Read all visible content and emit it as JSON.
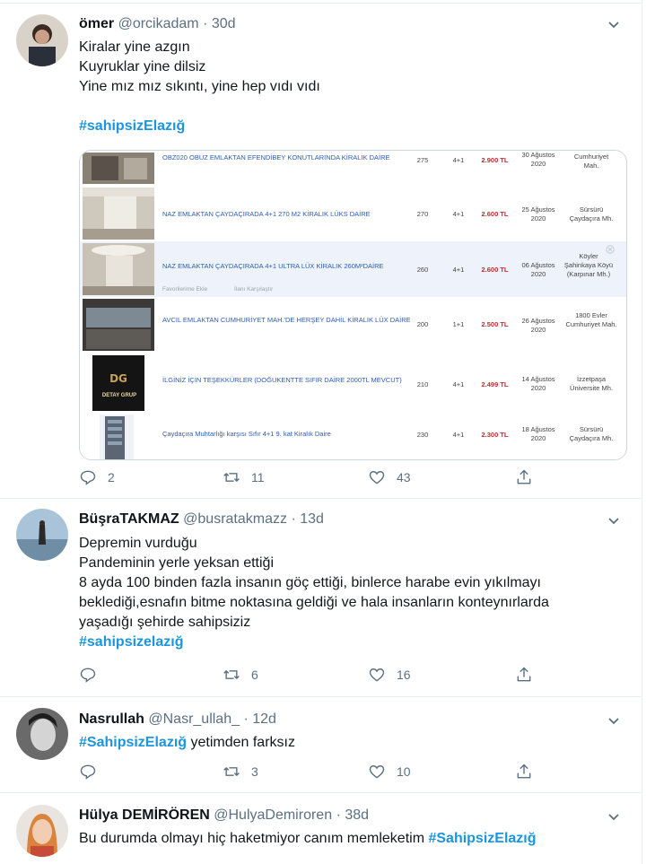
{
  "tweets": [
    {
      "name": "ömer",
      "handle": "@orcikadam",
      "sep": "·",
      "time": "30d",
      "lines": [
        "Kiralar yine azgın",
        "Kuyruklar yine dilsiz",
        "Yine mız mız sıkıntı, yine hep vıdı vıdı"
      ],
      "hashtag": "#sahipsizElazığ",
      "replies": "2",
      "retweets": "11",
      "likes": "43"
    },
    {
      "name": "BüşraTAKMAZ",
      "handle": "@busratakmazz",
      "sep": "·",
      "time": "13d",
      "lines": [
        "Depremin vurduğu",
        "Pandeminin yerle yeksan ettiği",
        "8 ayda 100 binden fazla insanın göç ettiği, binlerce harabe evin yıkılmayı",
        "beklediği,esnafın bitme noktasına geldiği ve hala insanların konteynırlarda",
        "yaşadığı şehirde sahipsiziz"
      ],
      "hashtag": "#sahipsizelazığ",
      "replies": "",
      "retweets": "6",
      "likes": "16"
    },
    {
      "name": "Nasrullah",
      "handle": "@Nasr_ullah_",
      "sep": "·",
      "time": "12d",
      "hashtag": "#SahipsizElazığ",
      "text_after": " yetimden farksız",
      "replies": "",
      "retweets": "3",
      "likes": "10"
    },
    {
      "name": "Hülya DEMİRÖREN",
      "handle": "@HulyaDemiroren",
      "sep": "·",
      "time": "38d",
      "text_before": "Bu durumda olmayı hiç haketmiyor canım memleketim ",
      "hashtag": "#SahipsizElazığ"
    }
  ],
  "listings": [
    {
      "title": "OBZ020 OBUZ EMLAKTAN EFENDİBEY KONUTLARINDA KİRALIK DAİRE",
      "m2": "275",
      "rooms": "4+1",
      "price": "2.900 TL",
      "date1": "30 Ağustos",
      "date2": "2020",
      "loc1": "Cumhuriyet",
      "loc2": "Mah."
    },
    {
      "title": "NAZ EMLAKTAN ÇAYDAÇIRADA 4+1 270 M2 KİRALIK LÜKS DAİRE",
      "m2": "270",
      "rooms": "4+1",
      "price": "2.600 TL",
      "date1": "25 Ağustos",
      "date2": "2020",
      "loc1": "Sürsürü",
      "loc2": "Çaydaçıra Mh."
    },
    {
      "title": "NAZ EMLAKTAN ÇAYDAÇIRADA 4+1 ULTRA LÜX KİRALIK 260M²DAİRE",
      "m2": "260",
      "rooms": "4+1",
      "price": "2.600 TL",
      "date1": "06 Ağustos",
      "date2": "2020",
      "loc1": "Köyler",
      "loc2": "Şahinkaya Köyü (Karpınar Mh.)",
      "fav": "Favorilerime Ekle",
      "cmp": "İlanı Karşılaştır"
    },
    {
      "title": "AVCIL EMLAKTAN CUMHURİYET MAH.'DE HERŞEY DAHİL KİRALIK LÜX DAİRE",
      "m2": "200",
      "rooms": "1+1",
      "price": "2.500 TL",
      "date1": "26 Ağustos",
      "date2": "2020",
      "loc1": "1800 Evler",
      "loc2": "Cumhuriyet Mah."
    },
    {
      "title": "İLGİNİZ İÇİN TEŞEKKÜRLER (DOĞUKENTTE SIFIR DAİRE 2000TL MEVCUT)",
      "m2": "210",
      "rooms": "4+1",
      "price": "2.499 TL",
      "date1": "14 Ağustos",
      "date2": "2020",
      "loc1": "İzzetpaşa",
      "loc2": "Üniversite Mh.",
      "logo": "DETAY GRUP"
    },
    {
      "title": "Çaydaçıra Muhtarlığı karşısı Sıfır 4+1 9. kat Kiralık Daire",
      "m2": "230",
      "rooms": "4+1",
      "price": "2.300 TL",
      "date1": "18 Ağustos",
      "date2": "2020",
      "loc1": "Sürsürü",
      "loc2": "Çaydaçıra Mh."
    }
  ],
  "colors": {
    "hashtag": "#1b95e0",
    "muted": "#5b7083",
    "price": "#c5262f",
    "listing_title": "#2a5cb8"
  },
  "icons": [
    "reply-icon",
    "retweet-icon",
    "like-icon",
    "share-icon",
    "chevron-down-icon"
  ]
}
